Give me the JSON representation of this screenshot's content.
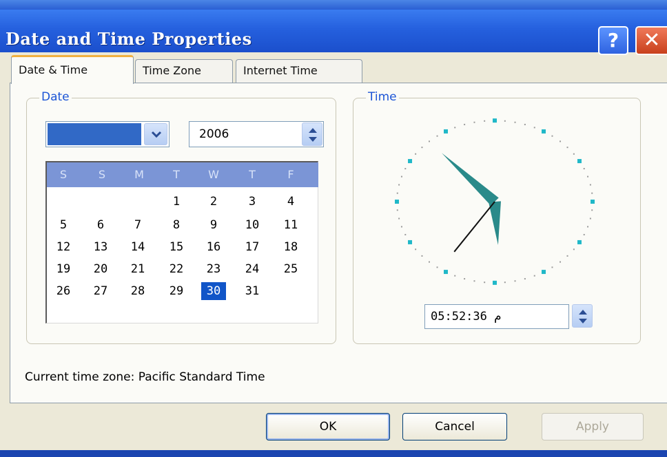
{
  "window": {
    "title": "Date and Time Properties",
    "help_label": "?",
    "close_label": "✕"
  },
  "tabs": [
    {
      "label": "Date & Time",
      "active": true
    },
    {
      "label": "Time Zone",
      "active": false
    },
    {
      "label": "Internet Time",
      "active": false
    }
  ],
  "date_group": {
    "legend": "Date",
    "month_value": "",
    "year_value": "2006",
    "weekday_headers": [
      "S",
      "S",
      "M",
      "T",
      "W",
      "T",
      "F"
    ],
    "weeks": [
      [
        "",
        "",
        "",
        "1",
        "2",
        "3",
        "4"
      ],
      [
        "5",
        "6",
        "7",
        "8",
        "9",
        "10",
        "11"
      ],
      [
        "12",
        "13",
        "14",
        "15",
        "16",
        "17",
        "18"
      ],
      [
        "19",
        "20",
        "21",
        "22",
        "23",
        "24",
        "25"
      ],
      [
        "26",
        "27",
        "28",
        "29",
        "30",
        "31",
        ""
      ]
    ],
    "selected_day": "30"
  },
  "time_group": {
    "legend": "Time",
    "time_value": "05:52:36 م",
    "clock": {
      "hours": 5,
      "minutes": 52,
      "seconds": 36
    }
  },
  "timezone_text": "Current time zone:  Pacific Standard Time",
  "buttons": {
    "ok": "OK",
    "cancel": "Cancel",
    "apply": "Apply",
    "apply_enabled": false
  },
  "colors": {
    "titlebar": "#2560de",
    "selection": "#1155c8",
    "hands": "#2a8a8a"
  }
}
